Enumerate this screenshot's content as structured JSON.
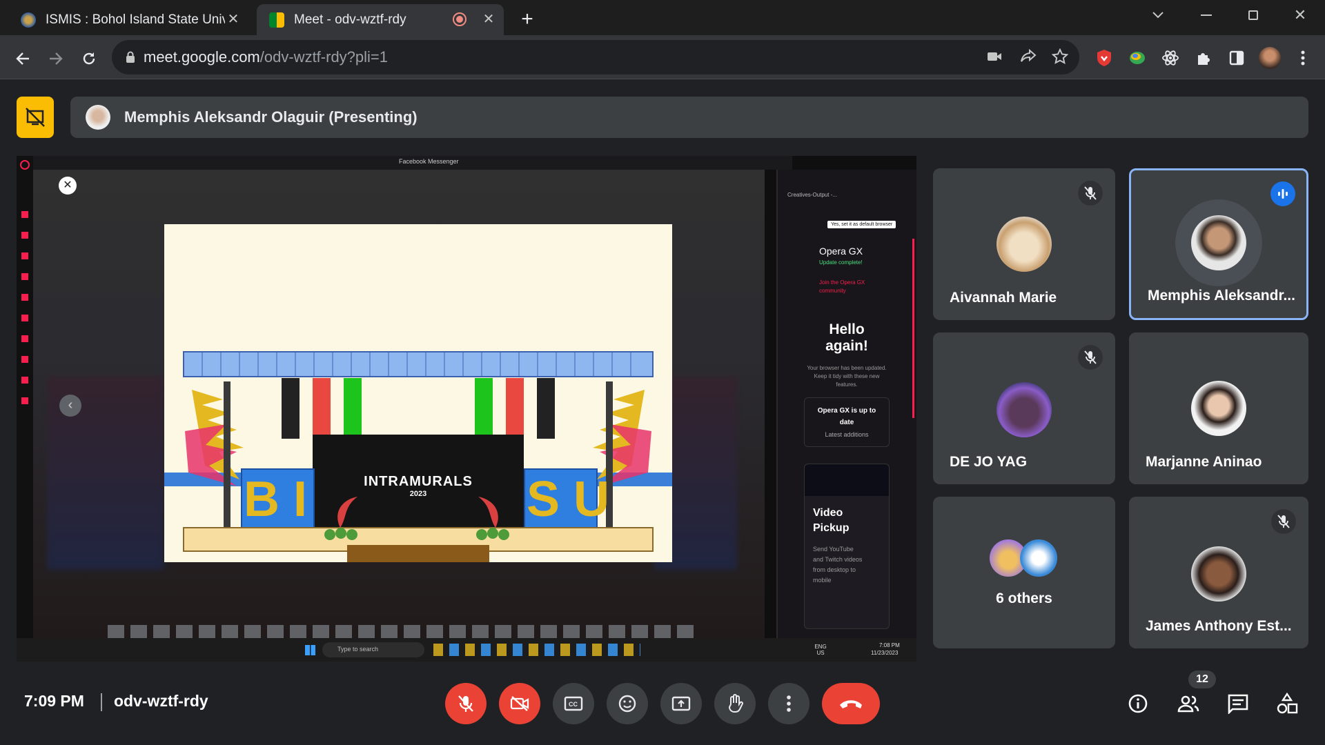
{
  "browser": {
    "tabs": [
      {
        "title": "ISMIS : Bohol Island State Univer",
        "active": false
      },
      {
        "title": "Meet - odv-wztf-rdy",
        "active": true
      }
    ],
    "url_host": "meet.google.com",
    "url_path": "/odv-wztf-rdy?pli=1"
  },
  "meet": {
    "presenting_banner": "Memphis Aleksandr Olaguir (Presenting)",
    "shared_screen": {
      "tab_title": "Facebook Messenger",
      "slide_title": "INTRAMURALS",
      "slide_year": "2023",
      "letters_left": "B I",
      "letters_right": "S U",
      "side_panel": {
        "tab": "Creatives-Output -...",
        "default_browser_btn": "Yes, set it as default browser",
        "brand": "Opera GX",
        "update": "Update complete!",
        "join": "Join the Opera GX community",
        "hello": "Hello again!",
        "tidy": "Your browser has been updated. Keep it tidy with these new features.",
        "uptodate": "Opera GX is up to date",
        "latest": "Latest additions",
        "video_title": "Video Pickup",
        "video_desc": "Send YouTube and Twitch videos from desktop to mobile"
      },
      "taskbar_search": "Type to search",
      "taskbar_lang": "ENG US",
      "taskbar_time": "7:08 PM",
      "taskbar_date": "11/23/2023"
    },
    "participants": [
      {
        "name": "Aivannah Marie",
        "muted": true
      },
      {
        "name": "Memphis Aleksandr...",
        "speaking": true
      },
      {
        "name": "DE JO YAG",
        "muted": true
      },
      {
        "name": "Marjanne Aninao",
        "muted": false
      },
      {
        "name": "6 others"
      },
      {
        "name": "James Anthony Est...",
        "muted": true
      }
    ],
    "time": "7:09 PM",
    "meeting_code": "odv-wztf-rdy",
    "people_count": "12"
  },
  "colors": {
    "accent_blue": "#8ab4f8",
    "red": "#ea4335",
    "present_yellow": "#fbbc04"
  }
}
